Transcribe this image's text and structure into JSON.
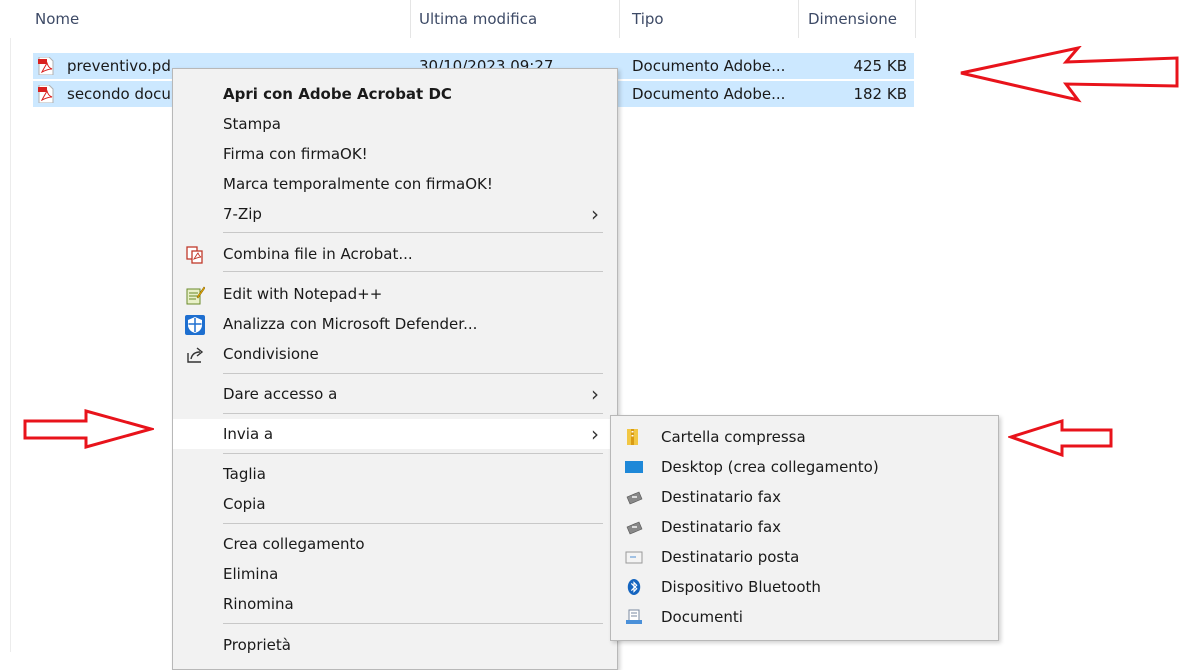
{
  "columns": {
    "name": "Nome",
    "modified": "Ultima modifica",
    "type": "Tipo",
    "size": "Dimensione"
  },
  "files": [
    {
      "name": "preventivo.pdf",
      "modified": "30/10/2023 09:27",
      "type": "Documento Adobe...",
      "size": "425 KB",
      "icon": "pdf-file-icon"
    },
    {
      "name": "secondo docu",
      "modified": "",
      "type": "Documento Adobe...",
      "size": "182 KB",
      "icon": "pdf-file-icon"
    }
  ],
  "context_menu": {
    "items": {
      "open_acrobat": "Apri con Adobe Acrobat DC",
      "print": "Stampa",
      "sign": "Firma con firmaOK!",
      "timestamp": "Marca temporalmente con firmaOK!",
      "zip": "7-Zip",
      "combine": "Combina file in Acrobat...",
      "notepad": "Edit with Notepad++",
      "defender": "Analizza con Microsoft Defender...",
      "share": "Condivisione",
      "give_access": "Dare accesso a",
      "send_to": "Invia a",
      "cut": "Taglia",
      "copy": "Copia",
      "create_shortcut": "Crea collegamento",
      "delete": "Elimina",
      "rename": "Rinomina",
      "properties": "Proprietà"
    }
  },
  "send_to_menu": {
    "items": [
      {
        "label": "Cartella compressa",
        "icon": "zip-folder-icon"
      },
      {
        "label": "Desktop (crea collegamento)",
        "icon": "desktop-icon"
      },
      {
        "label": "Destinatario fax",
        "icon": "fax-icon"
      },
      {
        "label": "Destinatario fax",
        "icon": "fax-icon"
      },
      {
        "label": "Destinatario posta",
        "icon": "mail-icon"
      },
      {
        "label": "Dispositivo Bluetooth",
        "icon": "bluetooth-icon"
      },
      {
        "label": "Documenti",
        "icon": "documents-icon"
      }
    ]
  },
  "colors": {
    "selection": "#cce8ff",
    "menu_bg": "#f2f2f2",
    "annotation_arrow": "#e8131b"
  }
}
